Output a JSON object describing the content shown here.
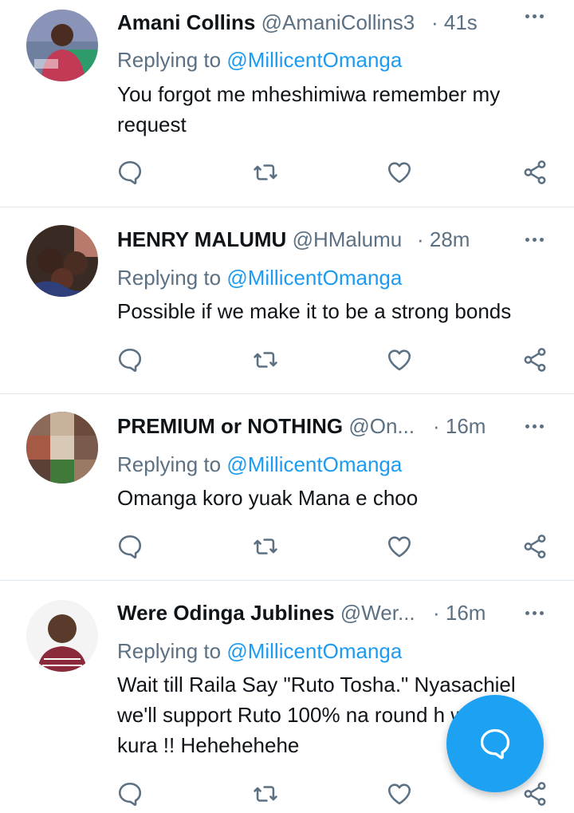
{
  "tweets": [
    {
      "name": "Amani Collins",
      "handle": "@AmaniCollins3",
      "time": "· 41s",
      "replying_prefix": "Replying to ",
      "replying_to": "@MillicentOmanga",
      "text": "You forgot me mheshimiwa remember my request"
    },
    {
      "name": "HENRY MALUMU",
      "handle": "@HMalumu",
      "time": "· 28m",
      "replying_prefix": "Replying to ",
      "replying_to": "@MillicentOmanga",
      "text": "Possible if we make it to be a strong bonds"
    },
    {
      "name": "PREMIUM or NOTHING",
      "handle": "@On...",
      "time": "· 16m",
      "replying_prefix": "Replying to ",
      "replying_to": "@MillicentOmanga",
      "text": "Omanga koro yuak Mana e choo"
    },
    {
      "name": "Were Odinga Jublines",
      "handle": "@Wer...",
      "time": "· 16m",
      "replying_prefix": "Replying to ",
      "replying_to": "@MillicentOmanga",
      "text": "Wait till Raila Say \"Ruto Tosha.\" Nyasachiel we'll support Ruto 100% na round h wakiiba kura !! Hehehehehe"
    }
  ],
  "icons": {
    "reply": "reply-icon",
    "retweet": "retweet-icon",
    "like": "heart-icon",
    "share": "share-icon",
    "more": "more-icon",
    "compose": "compose-reply-icon"
  },
  "colors": {
    "accent": "#1da1f2",
    "secondary_text": "#5b7083",
    "mention": "#1d9bf0",
    "divider": "#e1e8ed"
  }
}
